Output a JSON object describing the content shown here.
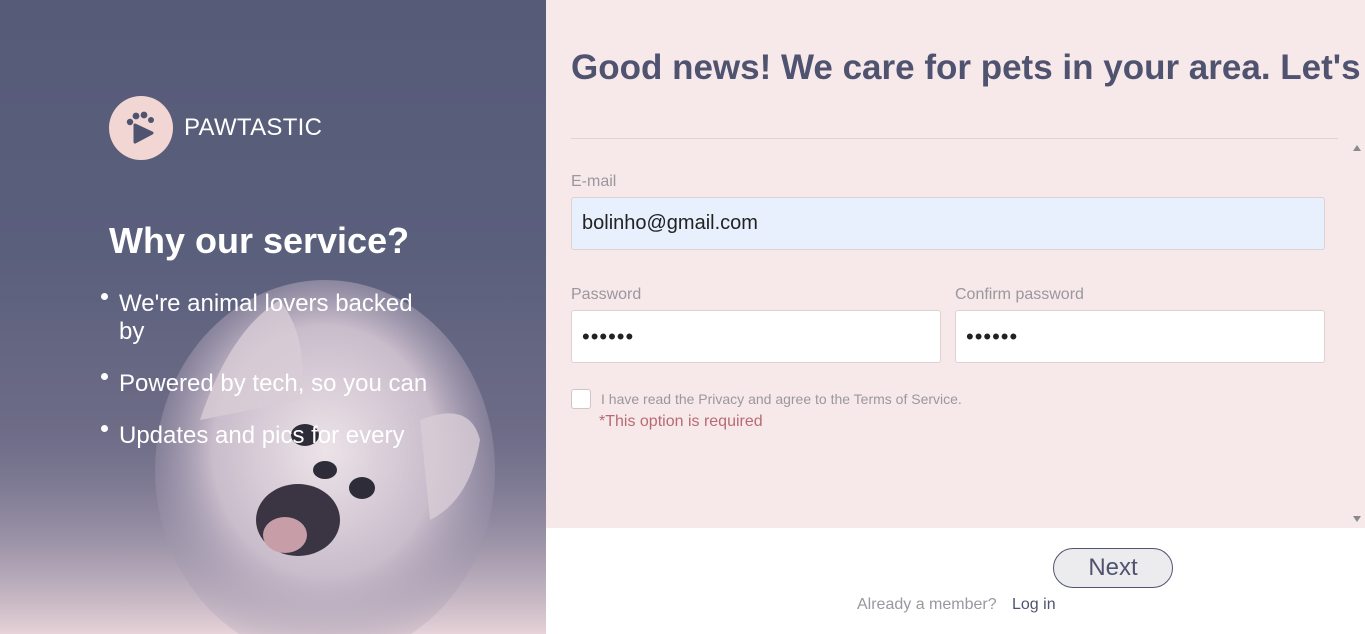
{
  "brand": {
    "name": "PAWTASTIC",
    "logo_icon": "paw-play-icon"
  },
  "sidebar": {
    "heading": "Why our service?",
    "benefits": [
      "We're animal lovers backed by",
      "Powered by tech, so you can",
      "Updates and pics for every"
    ]
  },
  "form": {
    "headline": "Good news! We care for pets in your area. Let's",
    "email_label": "E-mail",
    "email_value": "bolinho@gmail.com",
    "password_label": "Password",
    "password_value": "••••••",
    "confirm_label": "Confirm password",
    "confirm_value": "••••••",
    "terms_text": "I have read the Privacy and agree to the Terms of Service.",
    "required_text": "*This option is required"
  },
  "footer": {
    "next_label": "Next",
    "member_text": "Already a member?",
    "login_label": "Log in"
  },
  "colors": {
    "left_panel": "#565b78",
    "right_panel": "#f7e9e9",
    "accent": "#4f5370",
    "logo_bg": "#f1d6d4",
    "error": "#b86a74",
    "email_autofill": "#e8f0fe"
  }
}
